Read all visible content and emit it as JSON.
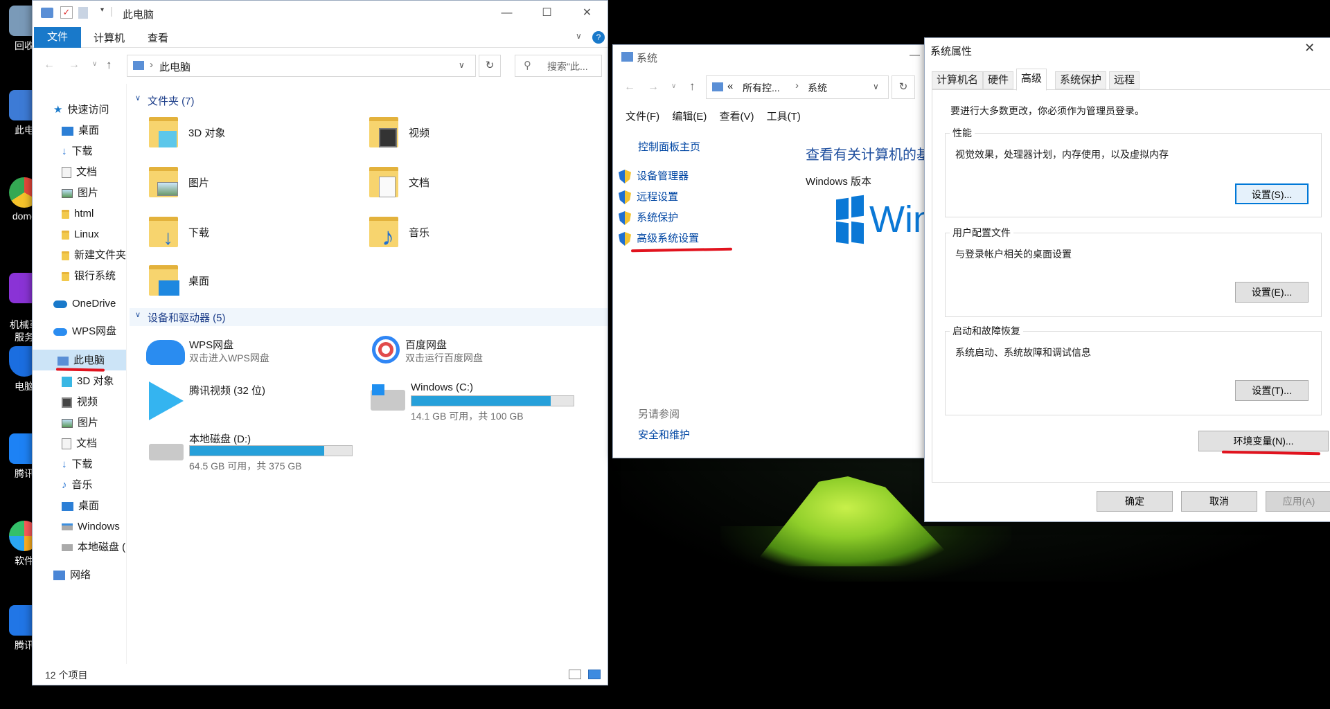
{
  "desktop": {
    "icons": [
      {
        "label": "回收",
        "color": "#7a9ab8"
      },
      {
        "label": "此电",
        "color": "#3d7bd6"
      },
      {
        "label": "domc",
        "color": "#e9473a"
      },
      {
        "label": "机械革\n服务",
        "color": "#8a33d6"
      },
      {
        "label": "电脑",
        "color": "#1b6ee0"
      },
      {
        "label": "腾讯",
        "color": "#1d82f5"
      },
      {
        "label": "软件",
        "color": "#2aa6f2"
      },
      {
        "label": "腾讯",
        "color": "#2176e6"
      }
    ]
  },
  "explorer": {
    "title": "此电脑",
    "ribbon_tabs": [
      "文件",
      "计算机",
      "查看"
    ],
    "address": "此电脑",
    "search_placeholder": "搜索\"此...",
    "nav": {
      "quick_access": "快速访问",
      "quick_items": [
        {
          "label": "桌面",
          "pinned": true
        },
        {
          "label": "下载",
          "pinned": true
        },
        {
          "label": "文档",
          "pinned": true
        },
        {
          "label": "图片",
          "pinned": true
        },
        {
          "label": "html",
          "pinned": false
        },
        {
          "label": "Linux",
          "pinned": false
        },
        {
          "label": "新建文件夹",
          "pinned": false
        },
        {
          "label": "银行系统",
          "pinned": false
        }
      ],
      "onedrive": "OneDrive",
      "wps": "WPS网盘",
      "this_pc": "此电脑",
      "pc_items": [
        "3D 对象",
        "视频",
        "图片",
        "文档",
        "下载",
        "音乐",
        "桌面",
        "Windows",
        "本地磁盘 ("
      ],
      "network": "网络"
    },
    "folders_header": "文件夹 (7)",
    "folders": [
      "3D 对象",
      "视频",
      "图片",
      "文档",
      "下载",
      "音乐",
      "桌面"
    ],
    "devices_header": "设备和驱动器 (5)",
    "devices": [
      {
        "name": "WPS网盘",
        "sub": "双击进入WPS网盘"
      },
      {
        "name": "百度网盘",
        "sub": "双击运行百度网盘"
      },
      {
        "name": "腾讯视频 (32 位)",
        "sub": ""
      },
      {
        "name": "Windows (C:)",
        "sub": "14.1 GB 可用，共 100 GB",
        "used_fraction": 0.859
      },
      {
        "name": "本地磁盘 (D:)",
        "sub": "64.5 GB 可用，共 375 GB",
        "used_fraction": 0.828
      }
    ],
    "status": "12 个项目"
  },
  "system_window": {
    "title": "系统",
    "address_parts": [
      "«",
      "所有控...",
      "系统"
    ],
    "menu": [
      "文件(F)",
      "编辑(E)",
      "查看(V)",
      "工具(T)"
    ],
    "home_link": "控制面板主页",
    "links": [
      "设备管理器",
      "远程设置",
      "系统保护",
      "高级系统设置"
    ],
    "see_also": "另请参阅",
    "see_also_link": "安全和维护",
    "heading": "查看有关计算机的基",
    "edition_label": "Windows 版本",
    "logo_text": "Windo"
  },
  "sysprops": {
    "title": "系统属性",
    "tabs": [
      "计算机名",
      "硬件",
      "高级",
      "系统保护",
      "远程"
    ],
    "active_tab": "高级",
    "admin_note": "要进行大多数更改，你必须作为管理员登录。",
    "perf": {
      "label": "性能",
      "desc": "视觉效果，处理器计划，内存使用，以及虚拟内存",
      "button": "设置(S)..."
    },
    "profile": {
      "label": "用户配置文件",
      "desc": "与登录帐户相关的桌面设置",
      "button": "设置(E)..."
    },
    "startup": {
      "label": "启动和故障恢复",
      "desc": "系统启动、系统故障和调试信息",
      "button": "设置(T)..."
    },
    "env_button": "环境变量(N)...",
    "ok": "确定",
    "cancel": "取消",
    "apply": "应用(A)"
  },
  "colors": {
    "accent": "#1979ca",
    "annotation": "#e1131e",
    "progress": "#26a0da"
  }
}
